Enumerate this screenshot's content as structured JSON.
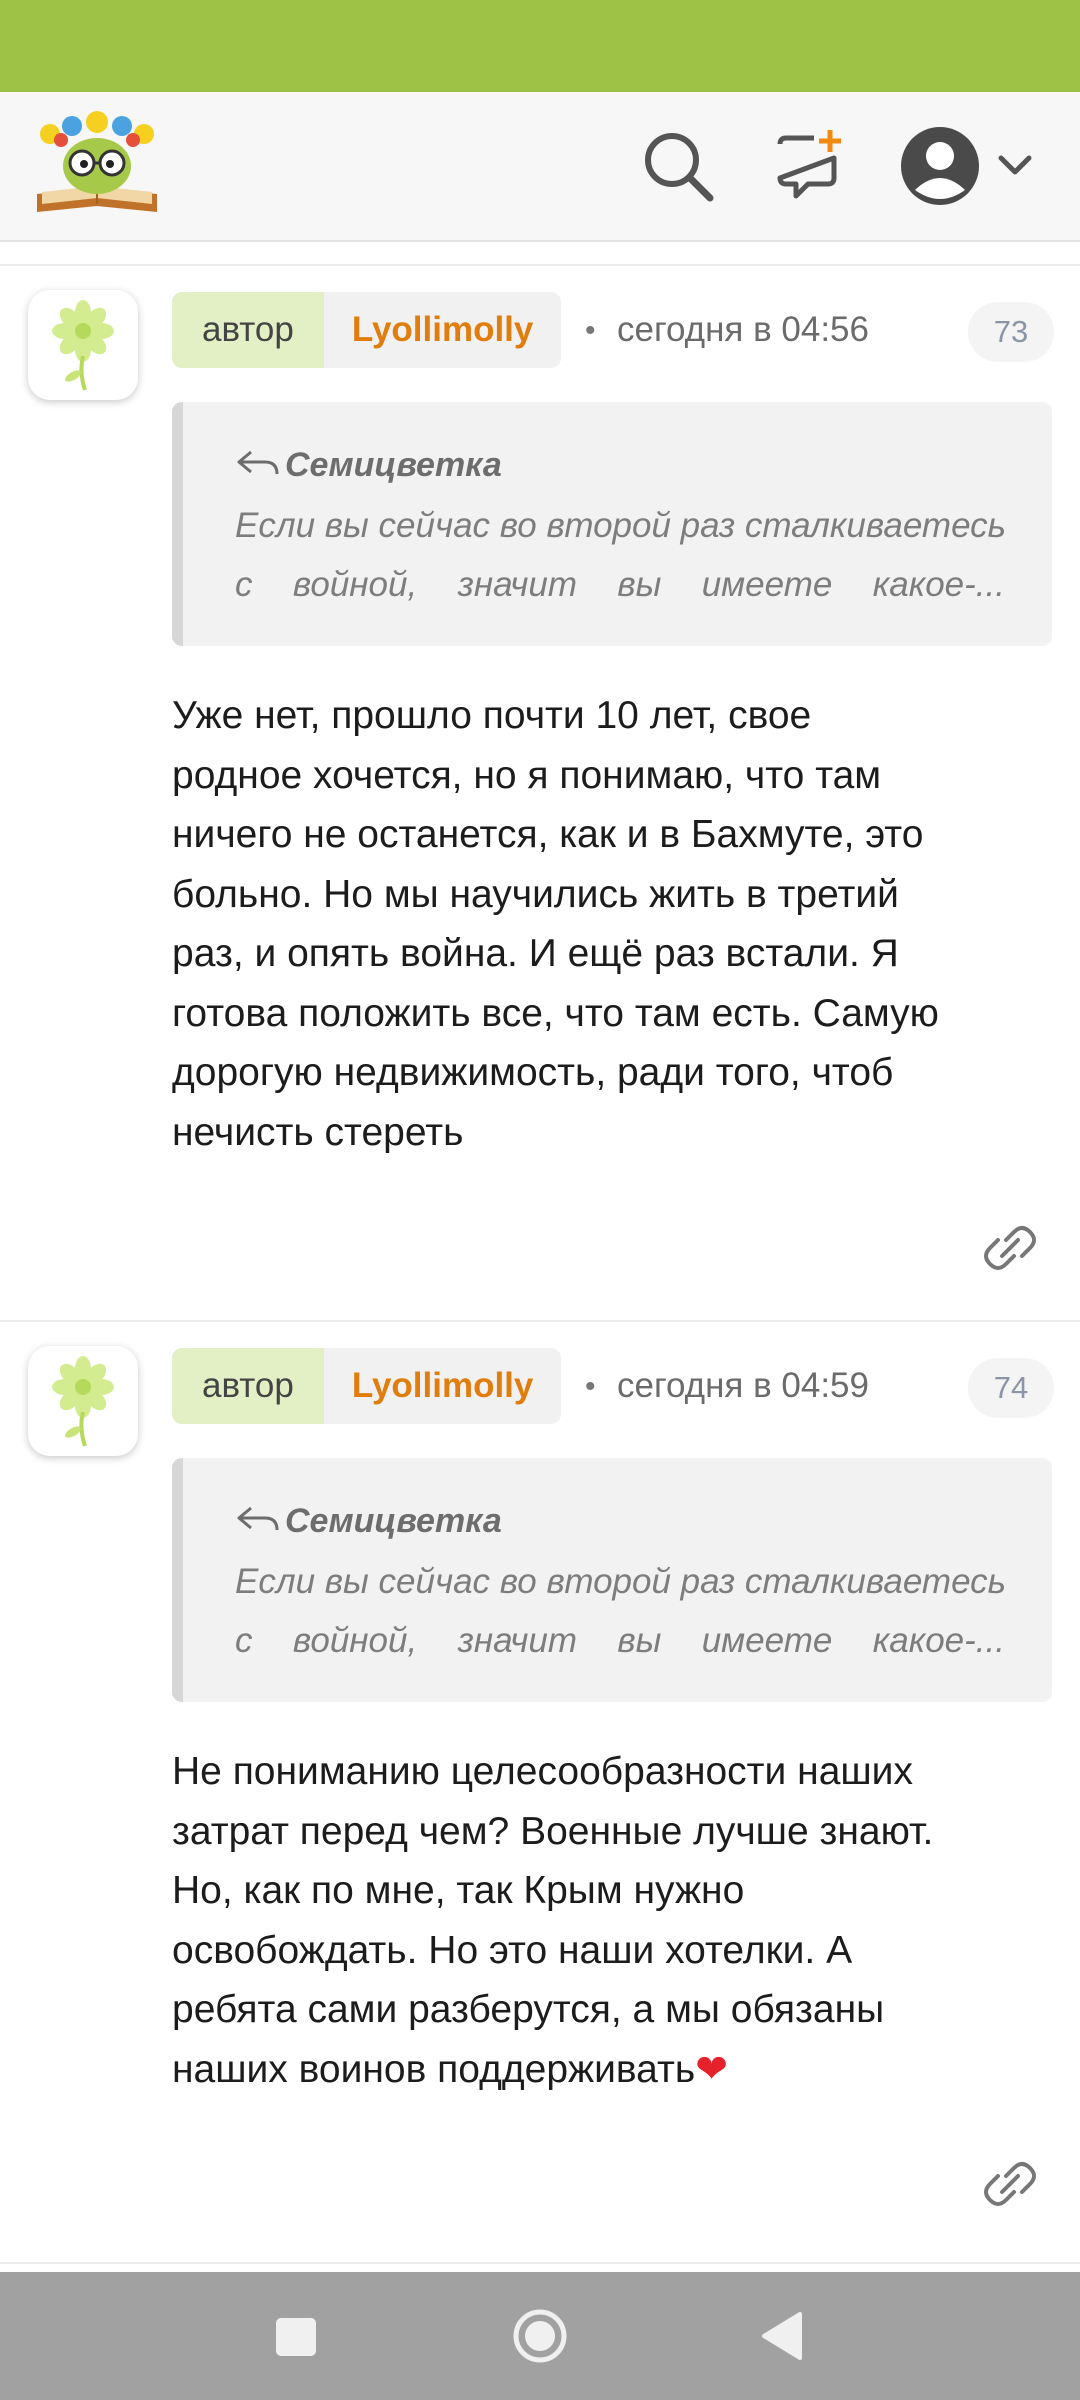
{
  "colors": {
    "status_bar": "#9dc246",
    "author_badge_bg": "#e3efc4",
    "username": "#e07d0c",
    "nav_bar": "#a1a1a1"
  },
  "header": {
    "icons": [
      "logo-icon",
      "search-icon",
      "new-post-icon",
      "profile-avatar-icon",
      "chevron-down-icon"
    ]
  },
  "comments": [
    {
      "author_tag": "автор",
      "username": "Lyollimolly",
      "separator": "•",
      "time": "сегодня в 04:56",
      "number": "73",
      "quote": {
        "author": "Семицветка",
        "line1": "Если вы сейчас во второй раз сталкиваетесь",
        "line2_words": [
          "с",
          "войной,",
          "значит",
          "вы",
          "имеете",
          "какое-..."
        ]
      },
      "text": [
        "Уже нет, прошло почти 10 лет, свое",
        "родное хочется, но я понимаю, что там",
        "ничего не останется, как и в Бахмуте, это",
        "больно. Но мы научились жить в третий",
        "раз, и опять война. И ещё раз встали. Я",
        "готова положить все, что там есть. Самую",
        "дорогую недвижимость, ради того, чтоб",
        "нечисть стереть"
      ]
    },
    {
      "author_tag": "автор",
      "username": "Lyollimolly",
      "separator": "•",
      "time": "сегодня в 04:59",
      "number": "74",
      "quote": {
        "author": "Семицветка",
        "line1": "Если вы сейчас во второй раз сталкиваетесь",
        "line2_words": [
          "с",
          "войной,",
          "значит",
          "вы",
          "имеете",
          "какое-..."
        ]
      },
      "text": [
        "Не пониманию целесообразности наших",
        "затрат перед чем? Военные лучше знают.",
        "Но, как по мне, так Крым нужно",
        "освобождать. Но это наши хотелки. А",
        "ребята сами разберутся, а мы обязаны",
        "наших воинов поддерживать"
      ],
      "text_suffix_emoji": "❤"
    }
  ],
  "navbar": {
    "icons": [
      "recents-square-icon",
      "home-circle-icon",
      "back-triangle-icon"
    ]
  }
}
